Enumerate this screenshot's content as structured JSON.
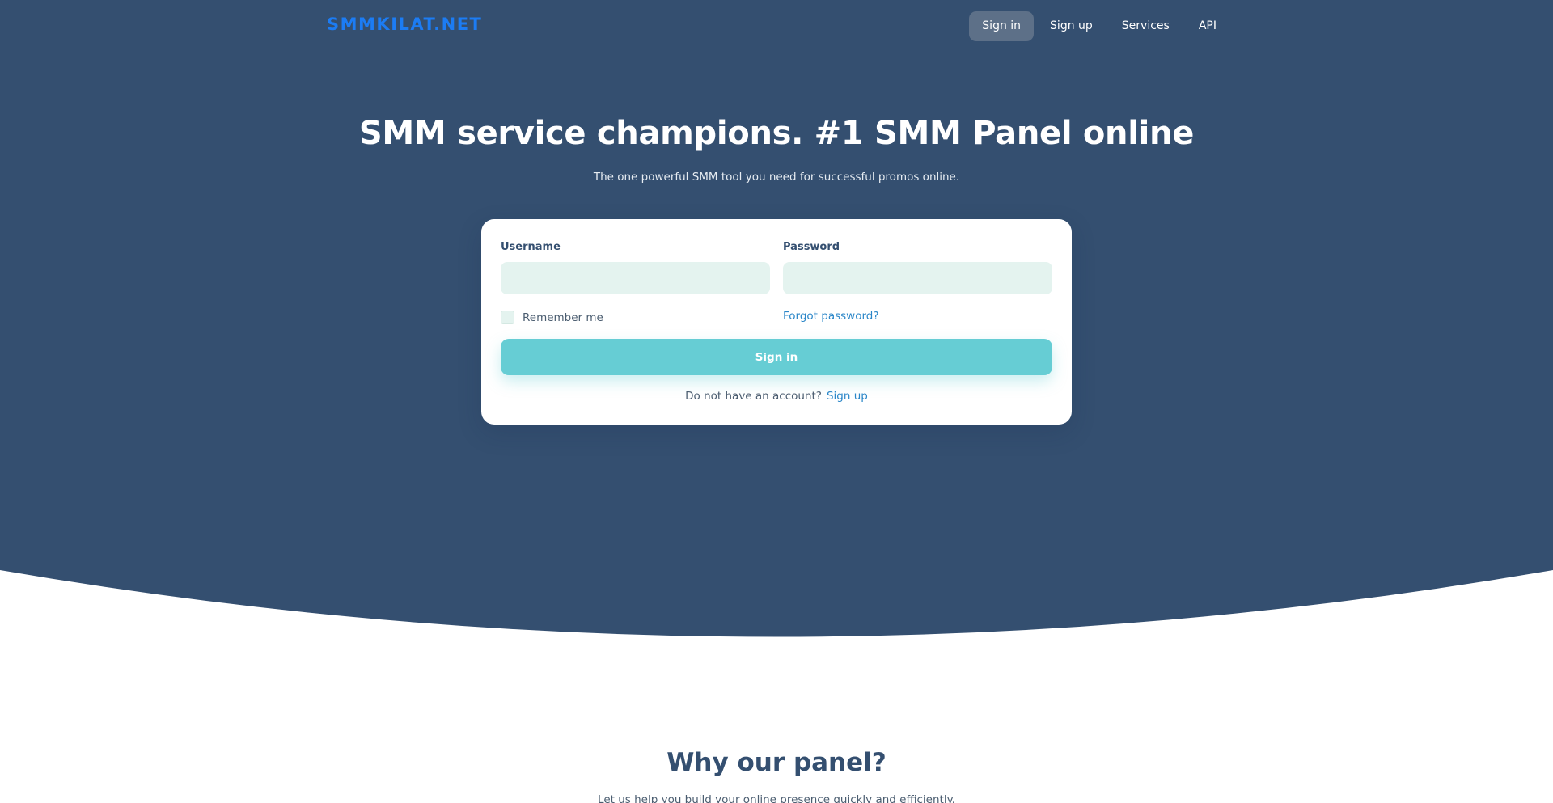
{
  "nav": {
    "logo": "SMMKILAT.NET",
    "links": [
      "Sign in",
      "Sign up",
      "Services",
      "API"
    ],
    "active_index": 0
  },
  "hero": {
    "title": "SMM service champions. #1 SMM Panel online",
    "subtitle": "The one powerful SMM tool you need for successful promos online."
  },
  "login_form": {
    "username_label": "Username",
    "username_value": "",
    "password_label": "Password",
    "password_value": "",
    "remember_label": "Remember me",
    "remember_checked": false,
    "forgot_label": "Forgot password?",
    "submit_label": "Sign in",
    "no_account_text": "Do not have an account?",
    "signup_link": "Sign up"
  },
  "why": {
    "title": "Why our panel?",
    "subtitle": "Let us help you build your online presence quickly and efficiently."
  },
  "colors": {
    "hero_bg": "#344f70",
    "logo": "#1c7cf4",
    "accent": "#66cdd4",
    "link": "#2a86c8",
    "input_bg": "#e4f3ef"
  }
}
